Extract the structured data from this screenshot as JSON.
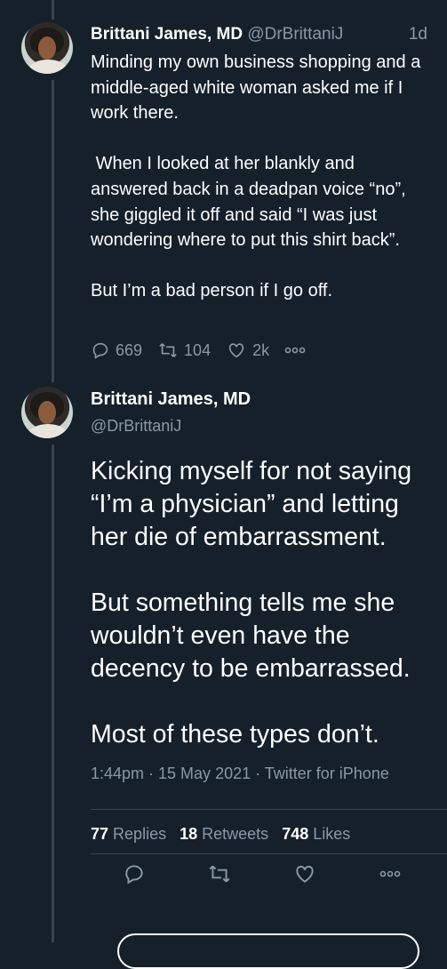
{
  "tweet1": {
    "name": "Brittani James, MD",
    "handle": "@DrBrittaniJ",
    "time": "1d",
    "paragraphs": [
      "Minding my own business shopping and a middle-aged white woman asked me if I work there.",
      " When I looked at her blankly and answered back in a deadpan voice “no”, she giggled it off and said “I was just wondering where to put this shirt back”.",
      "But I’m a bad person if I go off."
    ],
    "replies": "669",
    "retweets": "104",
    "likes": "2k"
  },
  "tweet2": {
    "name": "Brittani James, MD",
    "handle": "@DrBrittaniJ",
    "paragraphs": [
      "Kicking myself for not saying “I’m a physician” and letting her die of embarrassment.",
      "But something tells me she wouldn’t even have the decency to be embarrassed.",
      "Most of these types don’t."
    ],
    "meta": "1:44pm · 15 May 2021 · Twitter for iPhone",
    "replies_count": "77",
    "replies_label": "Replies",
    "retweets_count": "18",
    "retweets_label": "Retweets",
    "likes_count": "748",
    "likes_label": "Likes"
  },
  "colors": {
    "background": "#15202b",
    "secondary_text": "#8899a6",
    "divider": "#38444d"
  },
  "icons": [
    "reply-icon",
    "retweet-icon",
    "like-icon",
    "more-icon",
    "share-icon"
  ]
}
